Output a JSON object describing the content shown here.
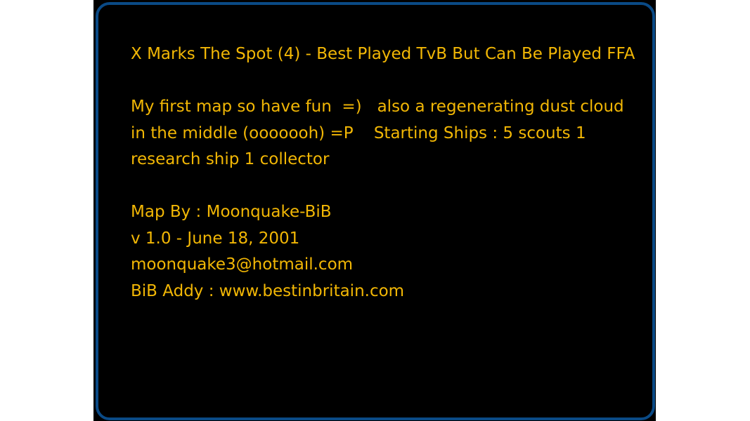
{
  "map_info": {
    "title": "X Marks The Spot (4) - Best Played TvB But Can Be Played FFA",
    "description": "My first map so have fun  =)   also a regenerating dust cloud in the middle (ooooooh) =P    Starting Ships : 5 scouts 1 research ship 1 collector",
    "author": "Map By : Moonquake-BiB",
    "version": "v 1.0 - June 18, 2001",
    "email": "moonquake3@hotmail.com",
    "website": "BiB Addy : www.bestinbritain.com"
  },
  "colors": {
    "text": "#f2b705",
    "border": "#0a4a86",
    "background": "#000000"
  }
}
